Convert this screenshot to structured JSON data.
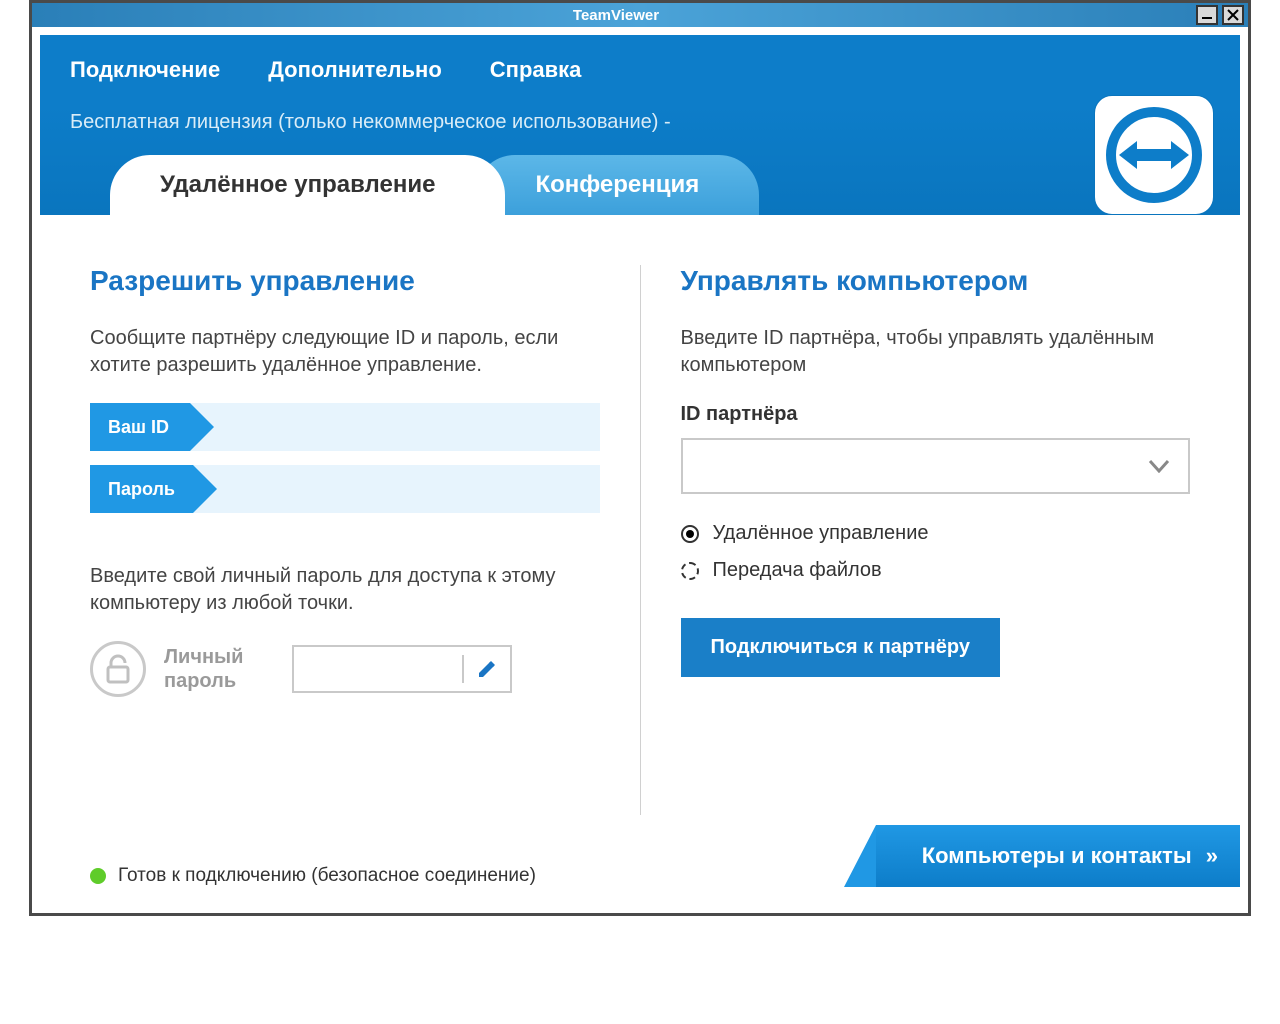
{
  "window": {
    "title": "TeamViewer"
  },
  "menu": {
    "connection": "Подключение",
    "extra": "Дополнительно",
    "help": "Справка"
  },
  "license": "Бесплатная лицензия (только некоммерческое использование) -",
  "tabs": {
    "remote": "Удалённое управление",
    "conference": "Конференция"
  },
  "left": {
    "title": "Разрешить управление",
    "text": "Сообщите партнёру следующие ID и пароль, если хотите разрешить удалённое управление.",
    "id_label": "Ваш ID",
    "pw_label": "Пароль",
    "hint": "Введите свой личный пароль для доступа к этому компьютеру из любой точки.",
    "personal_pw_label": "Личный пароль"
  },
  "right": {
    "title": "Управлять компьютером",
    "text": "Введите ID партнёра, чтобы управлять удалённым компьютером",
    "partner_id_label": "ID партнёра",
    "radio_remote": "Удалённое управление",
    "radio_files": "Передача файлов",
    "connect_btn": "Подключиться к партнёру"
  },
  "footer": {
    "status": "Готов к подключению (безопасное соединение)",
    "contacts": "Компьютеры и контакты"
  }
}
